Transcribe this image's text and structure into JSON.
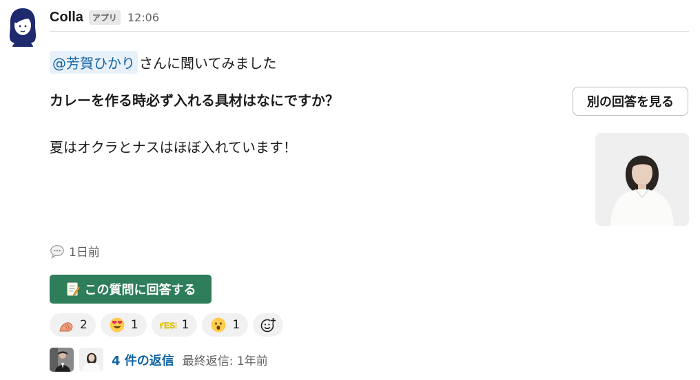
{
  "message": {
    "sender": "Colla",
    "badge": "アプリ",
    "time": "12:06",
    "mention": "@芳賀ひかり",
    "mention_suffix": "さんに聞いてみました",
    "question": "カレーを作る時必ず入れる具材はなにですか？",
    "other_answer_button": "別の回答を見る",
    "answer": "夏はオクラとナスはほぼ入れています！",
    "posted": "1日前",
    "answer_button": "この質問に回答する"
  },
  "reactions": [
    {
      "icon": "hand-icon",
      "count": "2"
    },
    {
      "icon": "heart-eyes-icon",
      "count": "1"
    },
    {
      "icon": "yes-icon",
      "count": "1"
    },
    {
      "icon": "surprised-face-icon",
      "count": "1"
    }
  ],
  "thread": {
    "reply_count": "4 件の返信",
    "last_reply": "最終返信: 1年前"
  },
  "colors": {
    "accent_green": "#2e7d5b",
    "link_blue": "#1264a3",
    "muted": "#616061"
  }
}
